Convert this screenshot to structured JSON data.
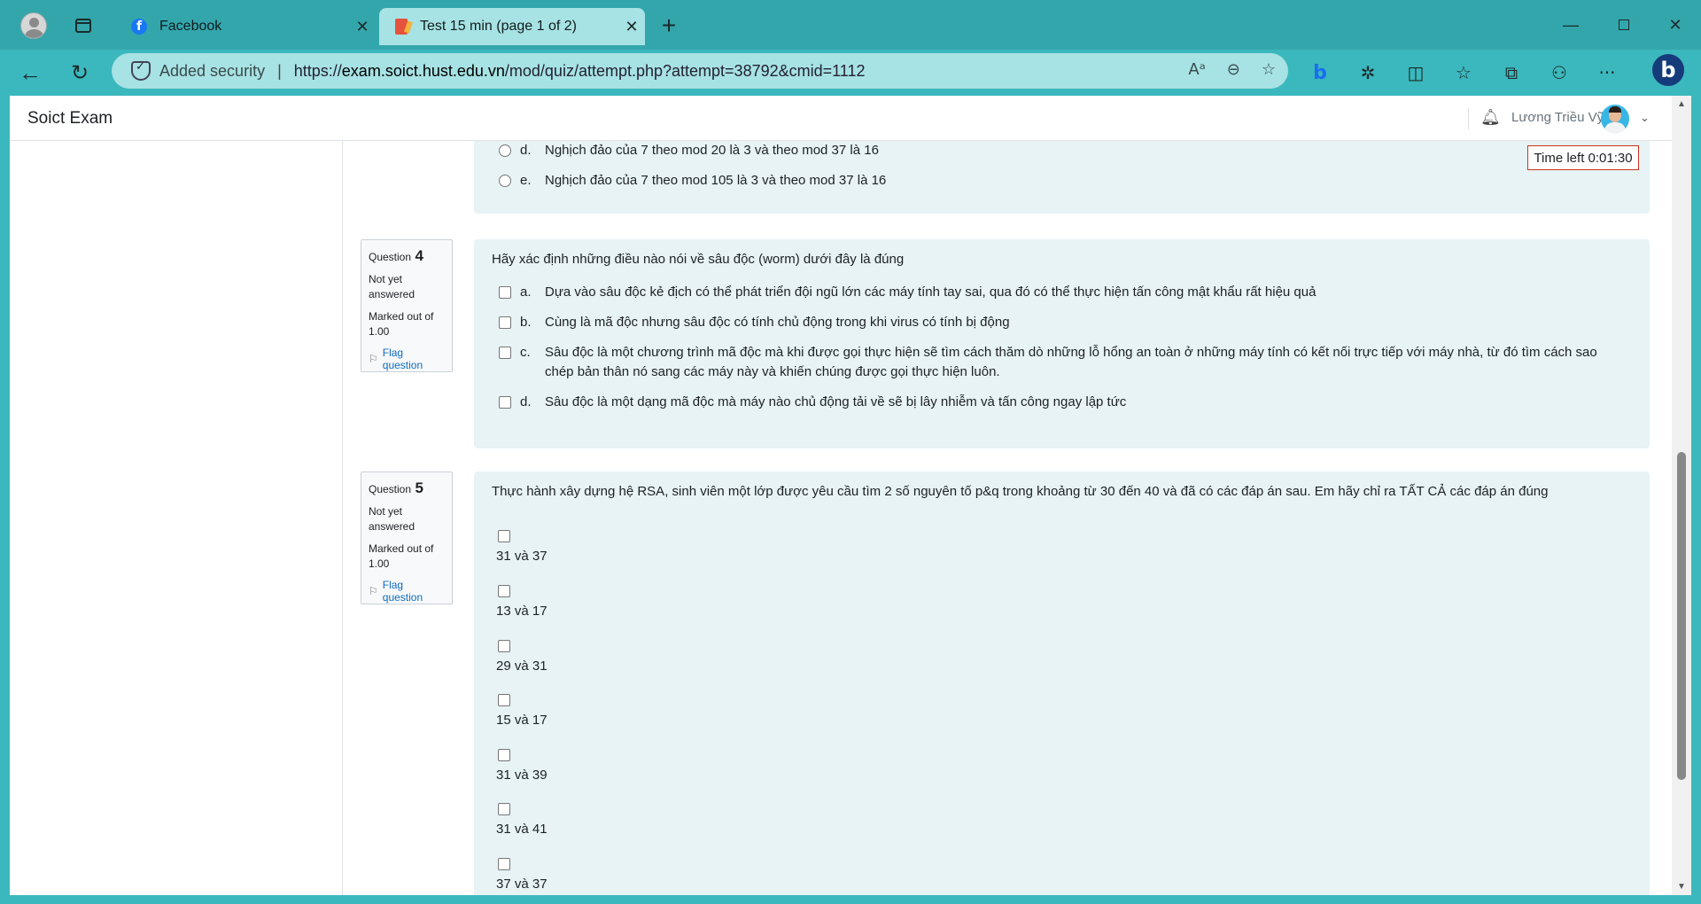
{
  "browser": {
    "tabs": [
      {
        "title": "Facebook",
        "icon": "facebook-icon"
      },
      {
        "title": "Test 15 min (page 1 of 2)",
        "icon": "quiz-icon",
        "active": true
      }
    ],
    "address": {
      "security_label": "Added security",
      "url_prefix": "https://",
      "url_domain": "exam.soict.hust.edu.vn",
      "url_path": "/mod/quiz/attempt.php?attempt=38792&cmid=1112"
    }
  },
  "page": {
    "brand": "Soict Exam",
    "user_name": "Lương Triều Vỹ",
    "timer_text": "Time left 0:01:30"
  },
  "question3": {
    "options": [
      {
        "letter": "d.",
        "text": "Nghịch đảo của 7 theo mod 20 là 3 và theo mod 37 là 16"
      },
      {
        "letter": "e.",
        "text": "Nghịch đảo của 7 theo mod 105 là 3 và theo mod 37 là 16"
      }
    ]
  },
  "question4": {
    "label": "Question",
    "number": "4",
    "state": "Not yet answered",
    "grade": "Marked out of 1.00",
    "flag": "Flag question",
    "text": "Hãy xác định những điều nào nói về sâu độc (worm) dưới đây là đúng",
    "options": [
      {
        "letter": "a.",
        "text": "Dựa vào sâu độc kẻ địch có thể phát triển đội ngũ lớn các máy tính tay sai, qua đó có thể thực hiện tấn công mật khẩu rất hiệu quả"
      },
      {
        "letter": "b.",
        "text": "Cùng là mã độc nhưng sâu độc có tính chủ động trong khi virus có tính bị động"
      },
      {
        "letter": "c.",
        "text": "Sâu độc là một chương trình mã độc mà khi được gọi thực hiện sẽ tìm cách thăm dò những lỗ hổng an toàn ở những máy tính có kết nối trực tiếp với máy nhà, từ đó tìm cách sao chép bản thân nó sang các máy này và khiến chúng được gọi thực hiện luôn."
      },
      {
        "letter": "d.",
        "text": "Sâu độc là một dạng mã độc mà máy nào chủ động tải về sẽ bị lây nhiễm và tấn công ngay lập tức"
      }
    ]
  },
  "question5": {
    "label": "Question",
    "number": "5",
    "state": "Not yet answered",
    "grade": "Marked out of 1.00",
    "flag": "Flag question",
    "text": "Thực hành xây dựng hệ RSA, sinh viên một lớp được yêu cầu tìm 2 số nguyên tố p&q trong khoảng từ 30 đến 40 và đã có các đáp án sau. Em hãy chỉ ra TẤT CẢ các đáp án đúng",
    "options": [
      "31  và 37",
      "13 và 17",
      "29 và 31",
      "15 và 17",
      "31 và 39",
      "31 và 41",
      "37 và 37"
    ]
  }
}
